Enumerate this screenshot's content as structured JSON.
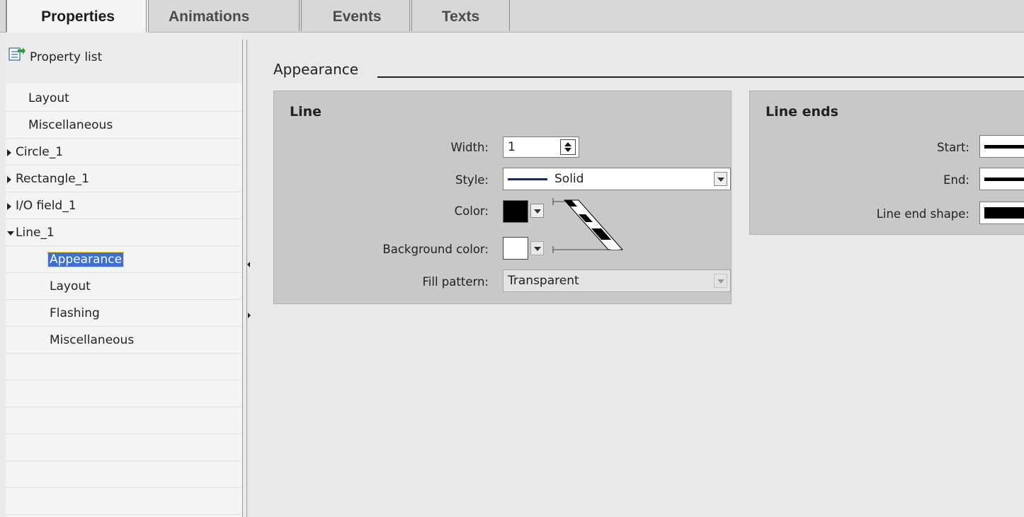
{
  "tabs": [
    {
      "label": "Properties",
      "active": true
    },
    {
      "label": "Animations",
      "active": false
    },
    {
      "label": "Events",
      "active": false
    },
    {
      "label": "Texts",
      "active": false
    }
  ],
  "nav": {
    "header": "Property list",
    "items": [
      {
        "label": "Layout"
      },
      {
        "label": "Miscellaneous"
      },
      {
        "label": "Circle_1",
        "expander": "collapsed"
      },
      {
        "label": "Rectangle_1",
        "expander": "collapsed"
      },
      {
        "label": "I/O field_1",
        "expander": "collapsed"
      },
      {
        "label": "Line_1",
        "expander": "expanded"
      },
      {
        "label": "Appearance",
        "selected": true
      },
      {
        "label": "Layout"
      },
      {
        "label": "Flashing"
      },
      {
        "label": "Miscellaneous"
      }
    ]
  },
  "section": {
    "title": "Appearance"
  },
  "line_group": {
    "title": "Line",
    "width_label": "Width:",
    "width_value": "1",
    "style_label": "Style:",
    "style_value": "Solid",
    "color_label": "Color:",
    "color_value": "#000000",
    "bgcolor_label": "Background color:",
    "bgcolor_value": "#ffffff",
    "fill_label": "Fill pattern:",
    "fill_value": "Transparent"
  },
  "line_ends_group": {
    "title": "Line ends",
    "start_label": "Start:",
    "end_label": "End:",
    "shape_label": "Line end shape:"
  },
  "colors": {
    "selection": "#3e6fd8",
    "group_bg": "#c8c8c8",
    "page_bg": "#e9e9e9"
  }
}
